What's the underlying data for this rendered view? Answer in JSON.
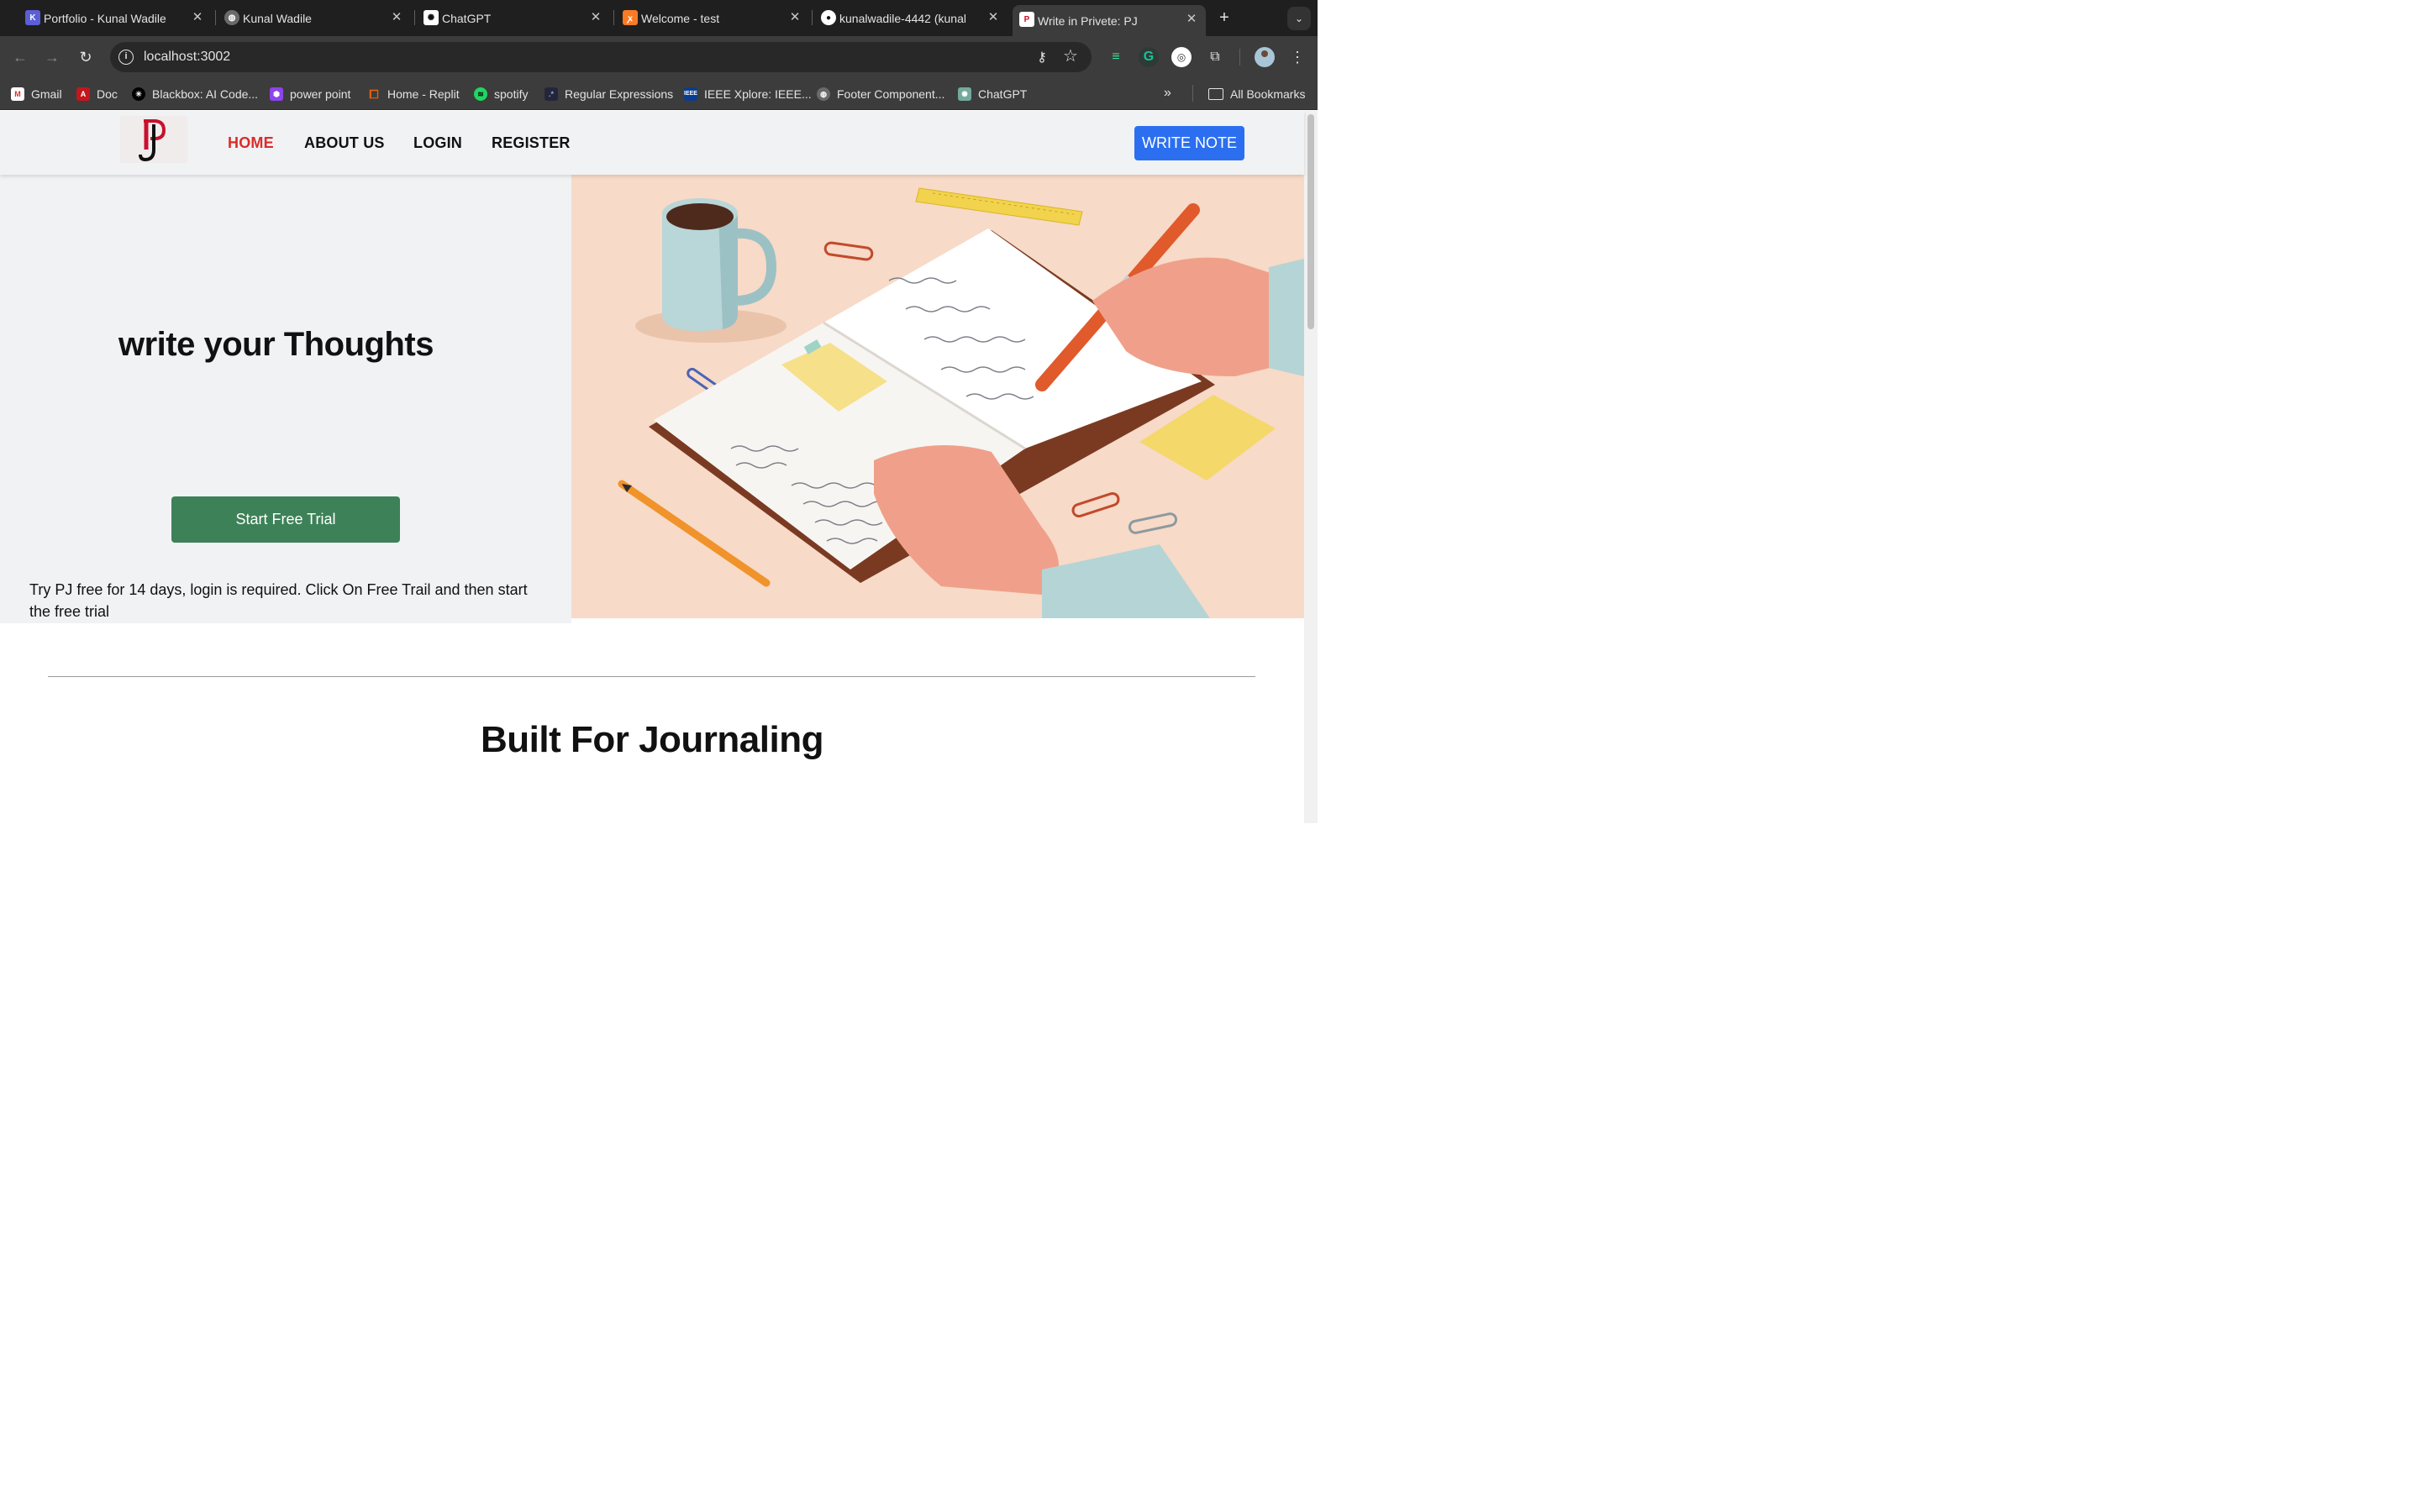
{
  "browser": {
    "tabs": [
      {
        "title": "Portfolio - Kunal Wadile",
        "icon": "portfolio-k-icon"
      },
      {
        "title": "Kunal Wadile",
        "icon": "globe-icon"
      },
      {
        "title": "ChatGPT",
        "icon": "chatgpt-icon"
      },
      {
        "title": "Welcome - test",
        "icon": "xampp-icon"
      },
      {
        "title": "kunalwadile-4442 (kunal",
        "icon": "github-icon"
      },
      {
        "title": "Write in Privete: PJ",
        "icon": "pj-logo-icon",
        "active": true
      }
    ],
    "url": "localhost:3002",
    "bookmarks": [
      {
        "label": "Gmail",
        "icon": "gmail-icon"
      },
      {
        "label": "Doc",
        "icon": "pdf-icon"
      },
      {
        "label": "Blackbox: AI Code...",
        "icon": "blackbox-icon"
      },
      {
        "label": "power point",
        "icon": "powerpoint-icon"
      },
      {
        "label": "Home - Replit",
        "icon": "replit-icon"
      },
      {
        "label": "spotify",
        "icon": "spotify-icon"
      },
      {
        "label": "Regular Expressions",
        "icon": "regex-icon"
      },
      {
        "label": "IEEE Xplore: IEEE...",
        "icon": "ieee-icon"
      },
      {
        "label": "Footer Component...",
        "icon": "globe-icon"
      },
      {
        "label": "ChatGPT",
        "icon": "chatgpt-icon"
      }
    ],
    "all_bookmarks_label": "All Bookmarks"
  },
  "site": {
    "nav": {
      "home": "HOME",
      "about": "ABOUT US",
      "login": "LOGIN",
      "register": "REGISTER",
      "write_note": "WRITE NOTE"
    },
    "hero": {
      "title": "write your Thoughts",
      "cta": "Start Free Trial",
      "note": "Try PJ free for 14 days, login is required. Click On Free Trail and then start the free trial"
    },
    "section_title": "Built For Journaling"
  },
  "colors": {
    "nav_active": "#dd2a2a",
    "write_button": "#2b6ff0",
    "trial_button": "#3d8158",
    "hero_bg": "#f0f2f3",
    "illustration_bg": "#f7dac7"
  }
}
